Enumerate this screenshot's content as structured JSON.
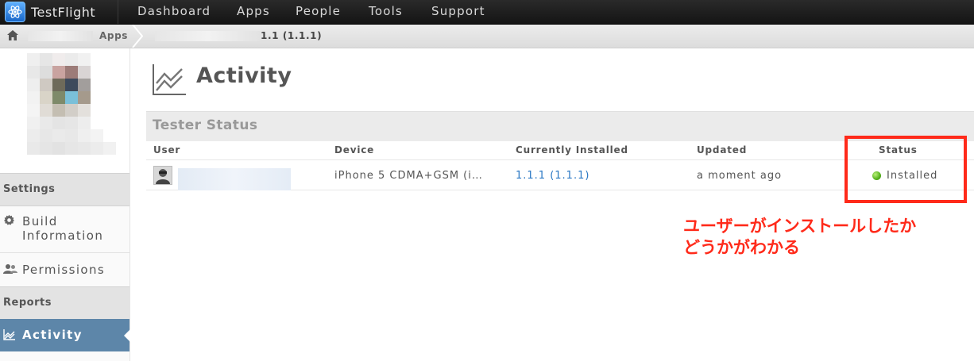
{
  "app": {
    "brand": "TestFlight"
  },
  "nav": {
    "items": [
      "Dashboard",
      "Apps",
      "People",
      "Tools",
      "Support"
    ]
  },
  "breadcrumb": {
    "apps_label": "Apps",
    "build_label": "1.1 (1.1.1)"
  },
  "sidebar": {
    "settings_heading": "Settings",
    "build_info_line1": "Build",
    "build_info_line2": "Information",
    "permissions": "Permissions",
    "reports_heading": "Reports",
    "activity": "Activity"
  },
  "page": {
    "title": "Activity"
  },
  "tester_status": {
    "title": "Tester Status",
    "columns": [
      "User",
      "Device",
      "Currently Installed",
      "Updated",
      "Status"
    ],
    "rows": [
      {
        "device": "iPhone 5 CDMA+GSM (i…",
        "installed": "1.1.1 (1.1.1)",
        "updated": "a moment ago",
        "status": "Installed"
      }
    ]
  },
  "annotation": {
    "line1": "ユーザーがインストールしたか",
    "line2": "どうかがわかる",
    "color": "#ff2a1a"
  },
  "colors": {
    "nav_bg": "#1c1c1c",
    "sidebar_active": "#5d86a9",
    "link": "#2a78c4",
    "status_green": "#55b11d"
  }
}
